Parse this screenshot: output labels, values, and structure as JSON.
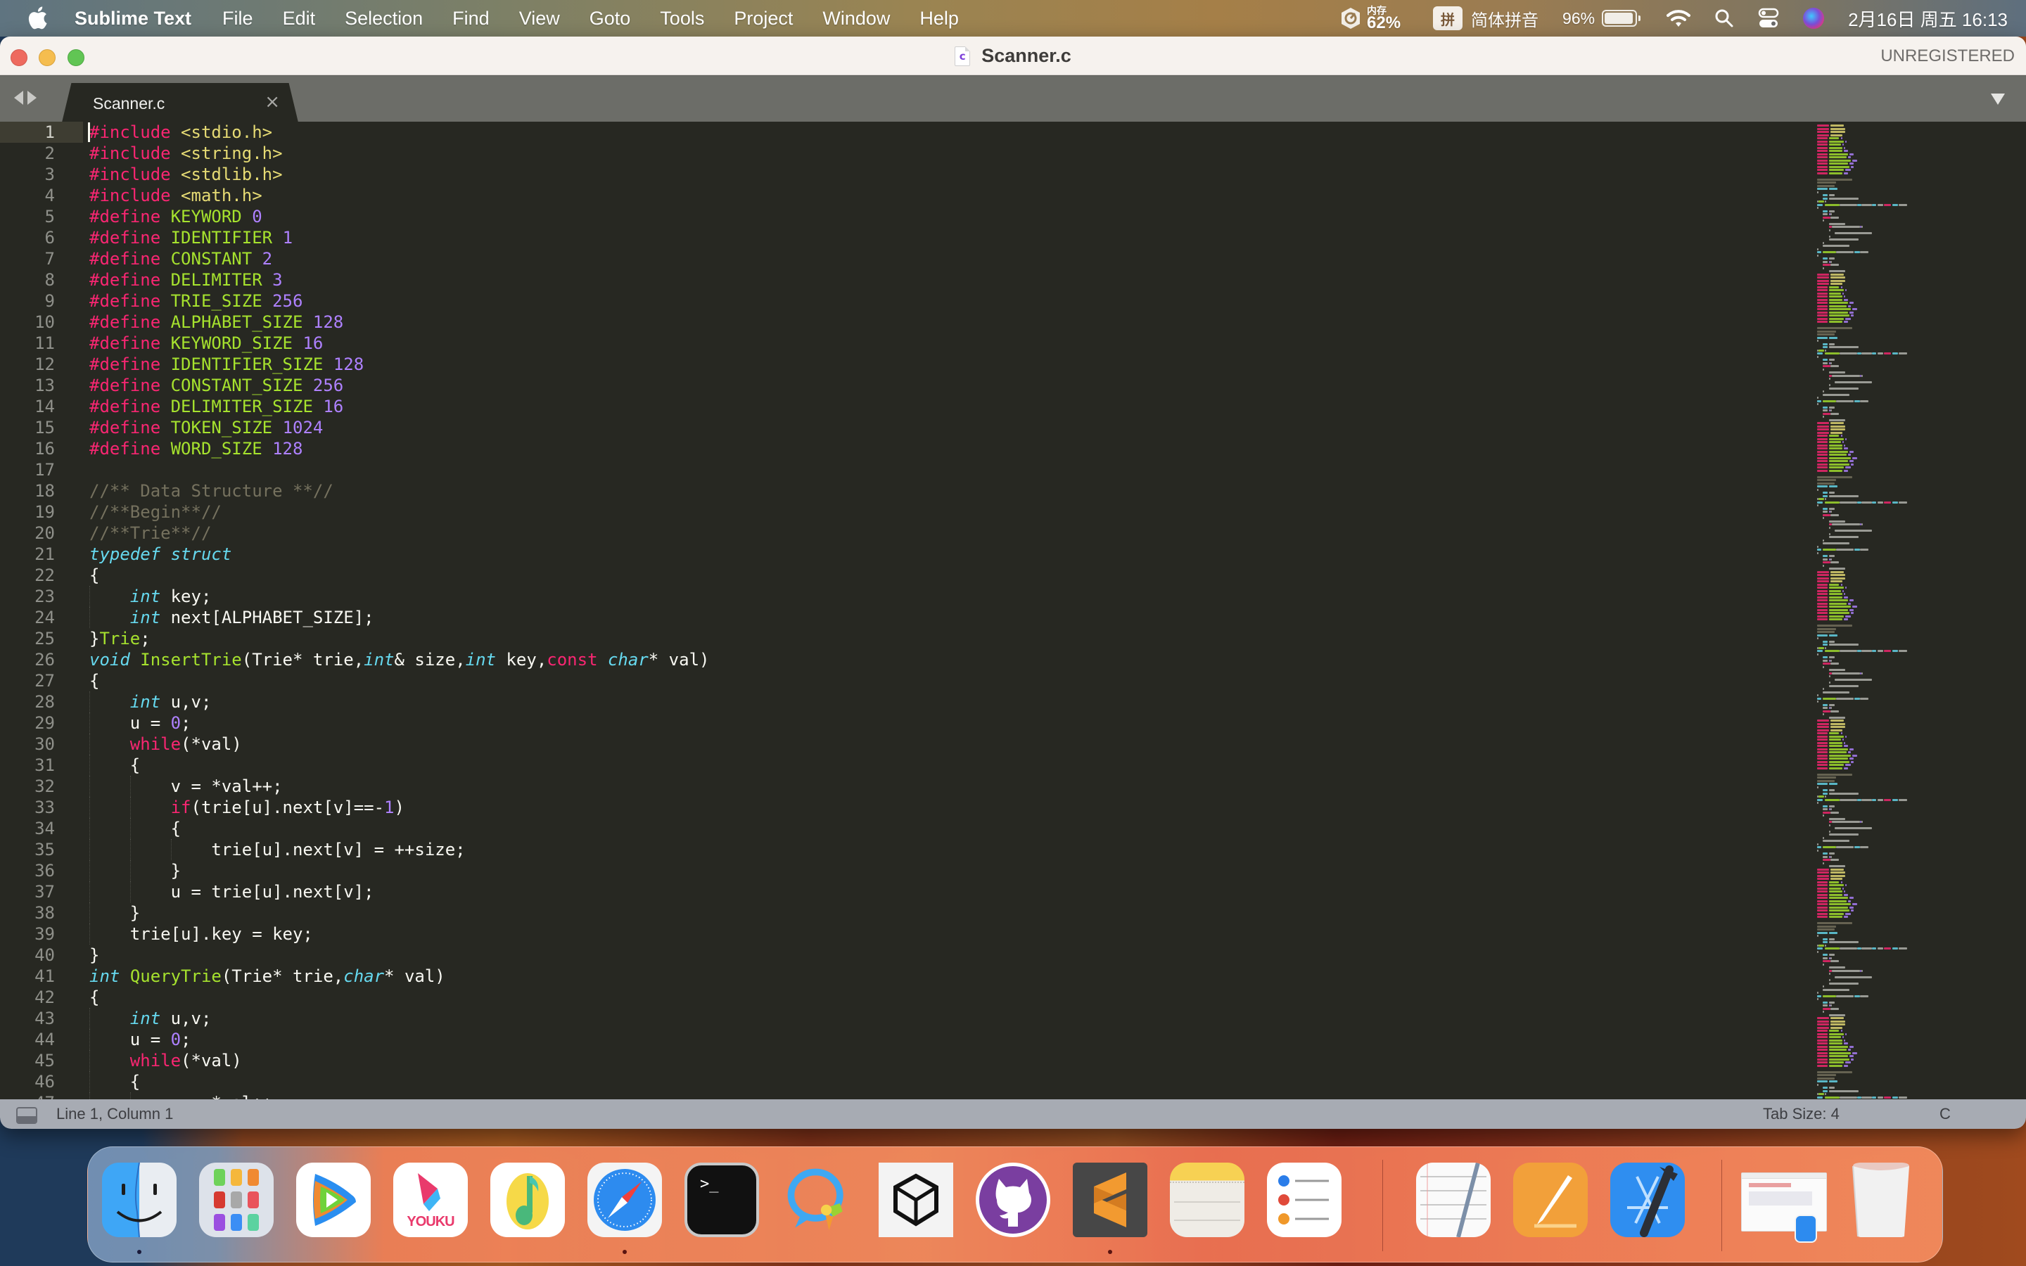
{
  "menubar": {
    "apple_icon": "apple-logo-icon",
    "app_name": "Sublime Text",
    "menus": [
      "File",
      "Edit",
      "Selection",
      "Find",
      "View",
      "Goto",
      "Tools",
      "Project",
      "Window",
      "Help"
    ],
    "status": {
      "memory_label": "内存",
      "memory_value": "62%",
      "input_method_badge": "拼",
      "input_method_name": "简体拼音",
      "battery_percent": "96%",
      "battery_level": 0.96,
      "datetime": "2月16日 周五 16:13"
    }
  },
  "window": {
    "title": "Scanner.c",
    "file_type_badge": "c",
    "registration_status": "UNREGISTERED"
  },
  "tabs": [
    {
      "label": "Scanner.c",
      "active": true,
      "close_glyph": "×"
    }
  ],
  "editor": {
    "active_line": 1,
    "colors": {
      "background": "#272822",
      "keyword": "#f92672",
      "string": "#e6db74",
      "function": "#a6e22e",
      "number": "#ae81ff",
      "comment": "#75715e",
      "type": "#66d9ef",
      "text": "#f8f8f2"
    },
    "lines": [
      [
        [
          "pp",
          "#include"
        ],
        [
          "plain",
          " "
        ],
        [
          "str",
          "<stdio.h>"
        ]
      ],
      [
        [
          "pp",
          "#include"
        ],
        [
          "plain",
          " "
        ],
        [
          "str",
          "<string.h>"
        ]
      ],
      [
        [
          "pp",
          "#include"
        ],
        [
          "plain",
          " "
        ],
        [
          "str",
          "<stdlib.h>"
        ]
      ],
      [
        [
          "pp",
          "#include"
        ],
        [
          "plain",
          " "
        ],
        [
          "str",
          "<math.h>"
        ]
      ],
      [
        [
          "pp",
          "#define"
        ],
        [
          "plain",
          " "
        ],
        [
          "macro",
          "KEYWORD"
        ],
        [
          "plain",
          " "
        ],
        [
          "num",
          "0"
        ]
      ],
      [
        [
          "pp",
          "#define"
        ],
        [
          "plain",
          " "
        ],
        [
          "macro",
          "IDENTIFIER"
        ],
        [
          "plain",
          " "
        ],
        [
          "num",
          "1"
        ]
      ],
      [
        [
          "pp",
          "#define"
        ],
        [
          "plain",
          " "
        ],
        [
          "macro",
          "CONSTANT"
        ],
        [
          "plain",
          " "
        ],
        [
          "num",
          "2"
        ]
      ],
      [
        [
          "pp",
          "#define"
        ],
        [
          "plain",
          " "
        ],
        [
          "macro",
          "DELIMITER"
        ],
        [
          "plain",
          " "
        ],
        [
          "num",
          "3"
        ]
      ],
      [
        [
          "pp",
          "#define"
        ],
        [
          "plain",
          " "
        ],
        [
          "macro",
          "TRIE_SIZE"
        ],
        [
          "plain",
          " "
        ],
        [
          "num",
          "256"
        ]
      ],
      [
        [
          "pp",
          "#define"
        ],
        [
          "plain",
          " "
        ],
        [
          "macro",
          "ALPHABET_SIZE"
        ],
        [
          "plain",
          " "
        ],
        [
          "num",
          "128"
        ]
      ],
      [
        [
          "pp",
          "#define"
        ],
        [
          "plain",
          " "
        ],
        [
          "macro",
          "KEYWORD_SIZE"
        ],
        [
          "plain",
          " "
        ],
        [
          "num",
          "16"
        ]
      ],
      [
        [
          "pp",
          "#define"
        ],
        [
          "plain",
          " "
        ],
        [
          "macro",
          "IDENTIFIER_SIZE"
        ],
        [
          "plain",
          " "
        ],
        [
          "num",
          "128"
        ]
      ],
      [
        [
          "pp",
          "#define"
        ],
        [
          "plain",
          " "
        ],
        [
          "macro",
          "CONSTANT_SIZE"
        ],
        [
          "plain",
          " "
        ],
        [
          "num",
          "256"
        ]
      ],
      [
        [
          "pp",
          "#define"
        ],
        [
          "plain",
          " "
        ],
        [
          "macro",
          "DELIMITER_SIZE"
        ],
        [
          "plain",
          " "
        ],
        [
          "num",
          "16"
        ]
      ],
      [
        [
          "pp",
          "#define"
        ],
        [
          "plain",
          " "
        ],
        [
          "macro",
          "TOKEN_SIZE"
        ],
        [
          "plain",
          " "
        ],
        [
          "num",
          "1024"
        ]
      ],
      [
        [
          "pp",
          "#define"
        ],
        [
          "plain",
          " "
        ],
        [
          "macro",
          "WORD_SIZE"
        ],
        [
          "plain",
          " "
        ],
        [
          "num",
          "128"
        ]
      ],
      [],
      [
        [
          "cmt",
          "//** Data Structure **//"
        ]
      ],
      [
        [
          "cmt",
          "//**Begin**//"
        ]
      ],
      [
        [
          "cmt",
          "//**Trie**//"
        ]
      ],
      [
        [
          "type",
          "typedef"
        ],
        [
          "plain",
          " "
        ],
        [
          "type",
          "struct"
        ]
      ],
      [
        [
          "plain",
          "{"
        ]
      ],
      [
        [
          "plain",
          "    "
        ],
        [
          "type",
          "int"
        ],
        [
          "plain",
          " key;"
        ]
      ],
      [
        [
          "plain",
          "    "
        ],
        [
          "type",
          "int"
        ],
        [
          "plain",
          " next[ALPHABET_SIZE];"
        ]
      ],
      [
        [
          "plain",
          "}"
        ],
        [
          "fn",
          "Trie"
        ],
        [
          "plain",
          ";"
        ]
      ],
      [
        [
          "type",
          "void"
        ],
        [
          "plain",
          " "
        ],
        [
          "fn",
          "InsertTrie"
        ],
        [
          "plain",
          "(Trie* trie,"
        ],
        [
          "type",
          "int"
        ],
        [
          "plain",
          "& size,"
        ],
        [
          "type",
          "int"
        ],
        [
          "plain",
          " key,"
        ],
        [
          "ctl",
          "const"
        ],
        [
          "plain",
          " "
        ],
        [
          "type",
          "char"
        ],
        [
          "plain",
          "* val)"
        ]
      ],
      [
        [
          "plain",
          "{"
        ]
      ],
      [
        [
          "plain",
          "    "
        ],
        [
          "type",
          "int"
        ],
        [
          "plain",
          " u,v;"
        ]
      ],
      [
        [
          "plain",
          "    u = "
        ],
        [
          "num",
          "0"
        ],
        [
          "plain",
          ";"
        ]
      ],
      [
        [
          "plain",
          "    "
        ],
        [
          "ctl",
          "while"
        ],
        [
          "plain",
          "(*val)"
        ]
      ],
      [
        [
          "plain",
          "    {"
        ]
      ],
      [
        [
          "plain",
          "        v = *val++;"
        ]
      ],
      [
        [
          "plain",
          "        "
        ],
        [
          "ctl",
          "if"
        ],
        [
          "plain",
          "(trie[u].next[v]==-"
        ],
        [
          "num",
          "1"
        ],
        [
          "plain",
          ")"
        ]
      ],
      [
        [
          "plain",
          "        {"
        ]
      ],
      [
        [
          "plain",
          "            trie[u].next[v] = ++size;"
        ]
      ],
      [
        [
          "plain",
          "        }"
        ]
      ],
      [
        [
          "plain",
          "        u = trie[u].next[v];"
        ]
      ],
      [
        [
          "plain",
          "    }"
        ]
      ],
      [
        [
          "plain",
          "    trie[u].key = key;"
        ]
      ],
      [
        [
          "plain",
          "}"
        ]
      ],
      [
        [
          "type",
          "int"
        ],
        [
          "plain",
          " "
        ],
        [
          "fn",
          "QueryTrie"
        ],
        [
          "plain",
          "(Trie* trie,"
        ],
        [
          "type",
          "char"
        ],
        [
          "plain",
          "* val)"
        ]
      ],
      [
        [
          "plain",
          "{"
        ]
      ],
      [
        [
          "plain",
          "    "
        ],
        [
          "type",
          "int"
        ],
        [
          "plain",
          " u,v;"
        ]
      ],
      [
        [
          "plain",
          "    u = "
        ],
        [
          "num",
          "0"
        ],
        [
          "plain",
          ";"
        ]
      ],
      [
        [
          "plain",
          "    "
        ],
        [
          "ctl",
          "while"
        ],
        [
          "plain",
          "(*val)"
        ]
      ],
      [
        [
          "plain",
          "    {"
        ]
      ],
      [
        [
          "plain",
          "        v = *val++;"
        ]
      ]
    ]
  },
  "statusbar": {
    "panel_toggle_icon": "panel-toggle-icon",
    "position": "Line 1, Column 1",
    "tab_size": "Tab Size: 4",
    "syntax": "C"
  },
  "dock": {
    "apps": [
      {
        "name": "Finder",
        "icon": "finder-icon",
        "running": true
      },
      {
        "name": "Launchpad",
        "icon": "launchpad-icon",
        "running": false
      },
      {
        "name": "Tencent Video",
        "icon": "tencent-video-icon",
        "running": false
      },
      {
        "name": "Youku",
        "icon": "youku-icon",
        "label": "YOUKU",
        "running": false
      },
      {
        "name": "QQ Music",
        "icon": "qq-music-icon",
        "running": false
      },
      {
        "name": "Safari",
        "icon": "safari-icon",
        "running": true
      },
      {
        "name": "Terminal",
        "icon": "terminal-icon",
        "label": ">_",
        "running": false
      },
      {
        "name": "Tencent Meeting",
        "icon": "chat-bubble-icon",
        "running": false
      },
      {
        "name": "Unity Hub",
        "icon": "unity-icon",
        "running": false
      },
      {
        "name": "GitHub Desktop",
        "icon": "github-icon",
        "running": false
      },
      {
        "name": "Sublime Text",
        "icon": "sublime-text-icon",
        "running": true
      },
      {
        "name": "Notes",
        "icon": "notes-icon",
        "running": false
      },
      {
        "name": "Reminders",
        "icon": "reminders-icon",
        "running": false
      }
    ],
    "apps_secondary": [
      {
        "name": "TextEdit",
        "icon": "textedit-icon"
      },
      {
        "name": "Pages",
        "icon": "pages-icon"
      },
      {
        "name": "Xcode",
        "icon": "xcode-icon"
      }
    ],
    "recent": [
      {
        "name": "Safari Window",
        "icon": "safari-window-thumbnail-icon"
      },
      {
        "name": "Trash",
        "icon": "trash-icon"
      }
    ]
  }
}
